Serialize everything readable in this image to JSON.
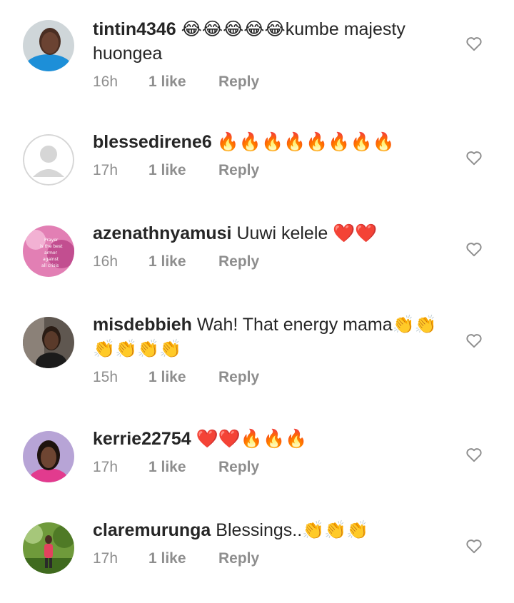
{
  "comments": [
    {
      "username": "tintin4346",
      "text": " 😂😂😂😂😂kumbe majesty huongea",
      "time": "16h",
      "likes": "1 like",
      "reply": "Reply"
    },
    {
      "username": "blessedirene6",
      "text": " 🔥🔥🔥🔥🔥🔥🔥🔥",
      "time": "17h",
      "likes": "1 like",
      "reply": "Reply"
    },
    {
      "username": "azenathnyamusi",
      "text": " Uuwi kelele ❤️❤️",
      "time": "16h",
      "likes": "1 like",
      "reply": "Reply",
      "avatar_text": [
        "Prayer",
        "is the best",
        "armor",
        "against",
        "all crisis"
      ]
    },
    {
      "username": "misdebbieh",
      "text": " Wah! That energy mama👏👏👏👏👏👏",
      "time": "15h",
      "likes": "1 like",
      "reply": "Reply"
    },
    {
      "username": "kerrie22754",
      "text": " ❤️❤️🔥🔥🔥",
      "time": "17h",
      "likes": "1 like",
      "reply": "Reply"
    },
    {
      "username": "claremurunga",
      "text": " Blessings..👏👏👏",
      "time": "17h",
      "likes": "1 like",
      "reply": "Reply"
    }
  ],
  "colors": {
    "text": "#262626",
    "muted": "#8e8e8e",
    "heart_outline": "#8e8e8e"
  },
  "icons": {
    "like": "heart-outline-icon"
  }
}
